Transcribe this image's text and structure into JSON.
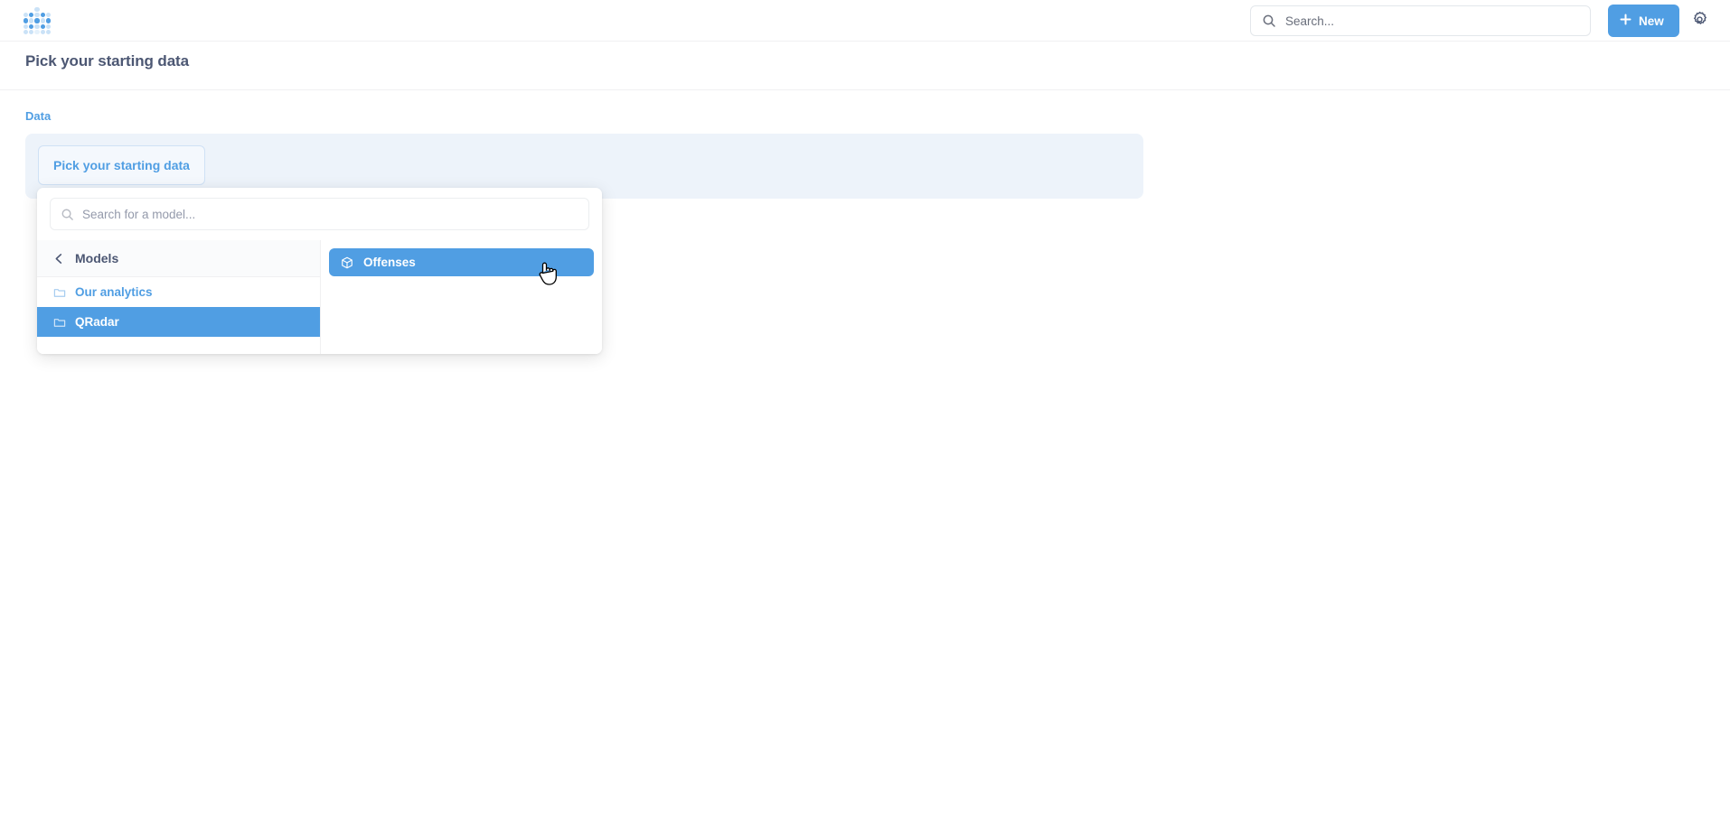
{
  "colors": {
    "brand": "#509ee3",
    "text": "#4c5773",
    "muted": "#696e7b",
    "banner_bg": "#edf3fa",
    "selected_bg": "#509ee3"
  },
  "topnav": {
    "logo_name": "metabase-logo",
    "search": {
      "placeholder": "Search...",
      "value": "",
      "icon": "search-icon"
    },
    "new_button": {
      "label": "New",
      "icon": "plus-icon"
    },
    "settings": {
      "icon": "gear-icon"
    }
  },
  "page": {
    "title": "Pick your starting data"
  },
  "query_builder": {
    "section_label": "Data",
    "pick_data_button": {
      "label": "Pick your starting data"
    }
  },
  "popover": {
    "search": {
      "placeholder": "Search for a model...",
      "value": "",
      "icon": "search-icon"
    },
    "left_panel": {
      "header": {
        "label": "Models",
        "back_icon": "chevron-left-icon"
      },
      "items": [
        {
          "label": "Our analytics",
          "icon": "folder-icon",
          "selected": false
        },
        {
          "label": "QRadar",
          "icon": "folder-icon",
          "selected": true
        }
      ]
    },
    "right_panel": {
      "items": [
        {
          "label": "Offenses",
          "icon": "model-cube-icon",
          "selected": true
        }
      ]
    }
  },
  "cursor": {
    "icon": "pointer-hand-cursor"
  }
}
